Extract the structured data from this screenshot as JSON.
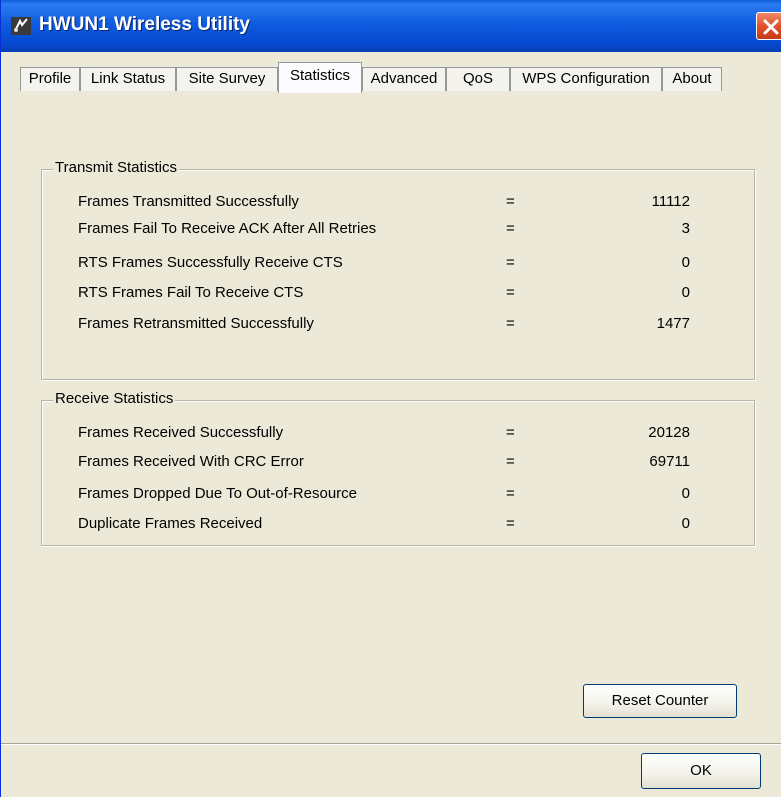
{
  "window": {
    "title": "HWUN1 Wireless Utility",
    "icon": "wireless-utility-icon",
    "close_icon": "close-icon"
  },
  "tabs": [
    {
      "label": "Profile",
      "active": false
    },
    {
      "label": "Link Status",
      "active": false
    },
    {
      "label": "Site Survey",
      "active": false
    },
    {
      "label": "Statistics",
      "active": true
    },
    {
      "label": "Advanced",
      "active": false
    },
    {
      "label": "QoS",
      "active": false
    },
    {
      "label": "WPS Configuration",
      "active": false
    },
    {
      "label": "About",
      "active": false
    }
  ],
  "transmit": {
    "title": "Transmit Statistics",
    "rows": [
      {
        "label": "Frames Transmitted Successfully",
        "eq": "=",
        "value": "11112"
      },
      {
        "label": "Frames Fail To Receive ACK After All Retries",
        "eq": "=",
        "value": "3"
      },
      {
        "label": "RTS Frames Successfully Receive CTS",
        "eq": "=",
        "value": "0"
      },
      {
        "label": "RTS Frames Fail To Receive CTS",
        "eq": "=",
        "value": "0"
      },
      {
        "label": "Frames Retransmitted Successfully",
        "eq": "=",
        "value": "1477"
      }
    ]
  },
  "receive": {
    "title": "Receive Statistics",
    "rows": [
      {
        "label": "Frames Received Successfully",
        "eq": "=",
        "value": "20128"
      },
      {
        "label": "Frames Received With CRC Error",
        "eq": "=",
        "value": "69711"
      },
      {
        "label": "Frames Dropped Due To Out-of-Resource",
        "eq": "=",
        "value": "0"
      },
      {
        "label": "Duplicate Frames Received",
        "eq": "=",
        "value": "0"
      }
    ]
  },
  "buttons": {
    "reset_counter": "Reset Counter",
    "ok": "OK"
  },
  "colors": {
    "titlebar": "#0549cf",
    "close_button": "#e0512e",
    "window_face": "#ece9d8",
    "button_border": "#003c74"
  }
}
